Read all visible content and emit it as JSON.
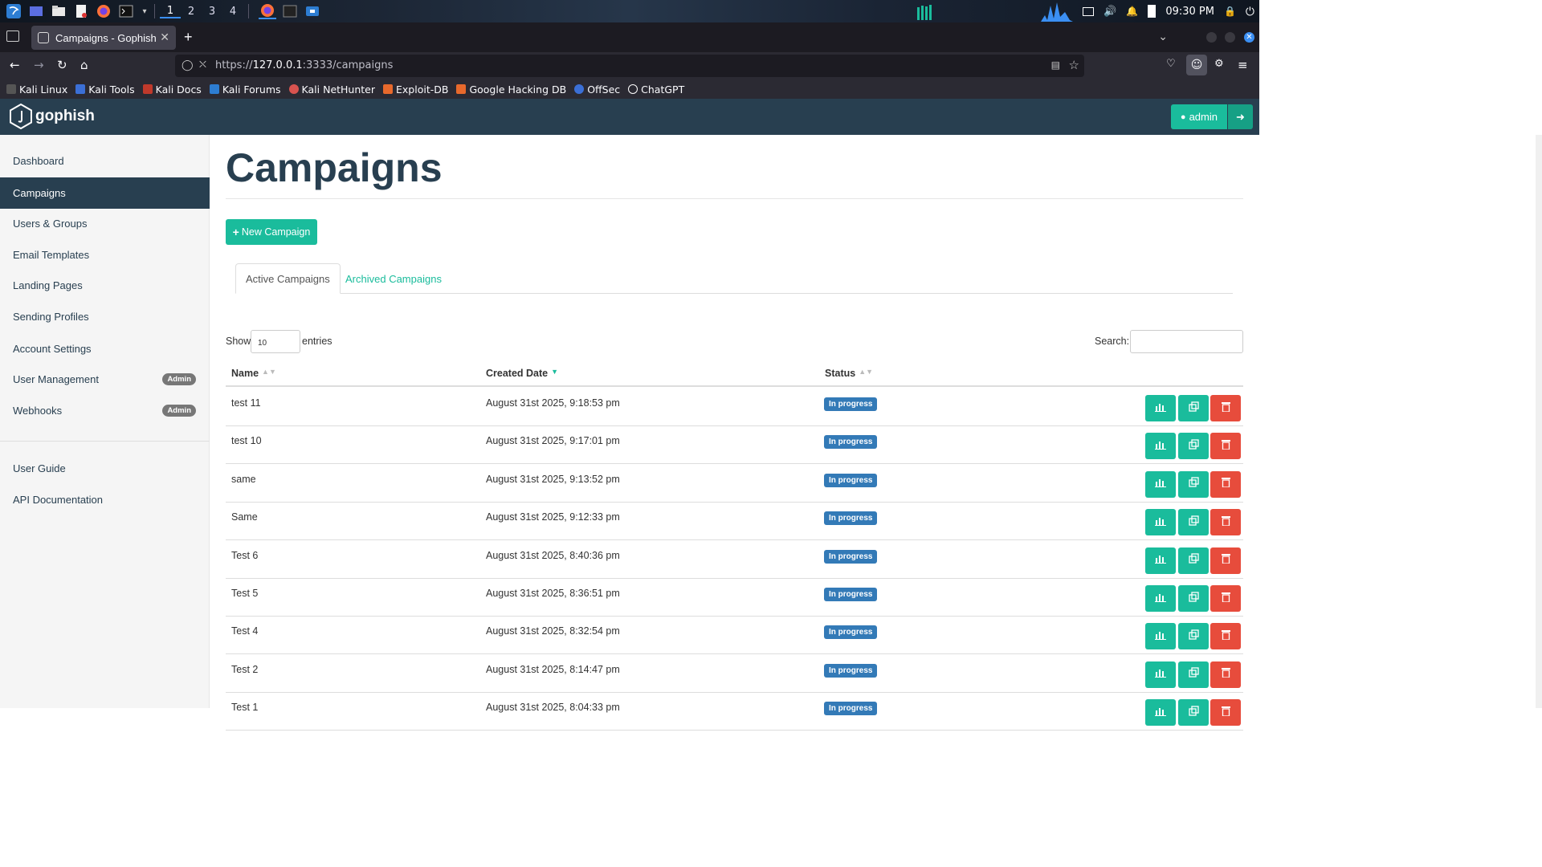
{
  "taskbar": {
    "workspaces": [
      "1",
      "2",
      "3",
      "4"
    ],
    "clock": "09:30 PM"
  },
  "browser": {
    "tab_title": "Campaigns - Gophish",
    "url_prefix": "https://",
    "url_host": "127.0.0.1",
    "url_rest": ":3333/campaigns",
    "bookmarks": [
      "Kali Linux",
      "Kali Tools",
      "Kali Docs",
      "Kali Forums",
      "Kali NetHunter",
      "Exploit-DB",
      "Google Hacking DB",
      "OffSec",
      "ChatGPT"
    ]
  },
  "app": {
    "brand": "gophish",
    "user_label": "admin",
    "accent_color": "#1abc9c",
    "nav_color": "#283f50"
  },
  "sidebar": {
    "items": [
      {
        "label": "Dashboard"
      },
      {
        "label": "Campaigns",
        "active": true
      },
      {
        "label": "Users & Groups"
      },
      {
        "label": "Email Templates"
      },
      {
        "label": "Landing Pages"
      },
      {
        "label": "Sending Profiles"
      },
      {
        "label": "Account Settings"
      },
      {
        "label": "User Management",
        "badge": "Admin"
      },
      {
        "label": "Webhooks",
        "badge": "Admin"
      }
    ],
    "footer_items": [
      {
        "label": "User Guide"
      },
      {
        "label": "API Documentation"
      }
    ]
  },
  "main": {
    "title": "Campaigns",
    "new_button": "New Campaign",
    "tabs": [
      "Active Campaigns",
      "Archived Campaigns"
    ],
    "show_label": "Show",
    "entries_value": "10",
    "entries_label": "entries",
    "search_label": "Search:",
    "table": {
      "columns": [
        "Name",
        "Created Date",
        "Status"
      ],
      "rows": [
        {
          "name": "test 11",
          "date": "August 31st 2025, 9:18:53 pm",
          "status": "In progress"
        },
        {
          "name": "test 10",
          "date": "August 31st 2025, 9:17:01 pm",
          "status": "In progress"
        },
        {
          "name": "same",
          "date": "August 31st 2025, 9:13:52 pm",
          "status": "In progress"
        },
        {
          "name": "Same",
          "date": "August 31st 2025, 9:12:33 pm",
          "status": "In progress"
        },
        {
          "name": "Test 6",
          "date": "August 31st 2025, 8:40:36 pm",
          "status": "In progress"
        },
        {
          "name": "Test 5",
          "date": "August 31st 2025, 8:36:51 pm",
          "status": "In progress"
        },
        {
          "name": "Test 4",
          "date": "August 31st 2025, 8:32:54 pm",
          "status": "In progress"
        },
        {
          "name": "Test 2",
          "date": "August 31st 2025, 8:14:47 pm",
          "status": "In progress"
        },
        {
          "name": "Test 1",
          "date": "August 31st 2025, 8:04:33 pm",
          "status": "In progress"
        }
      ]
    }
  }
}
